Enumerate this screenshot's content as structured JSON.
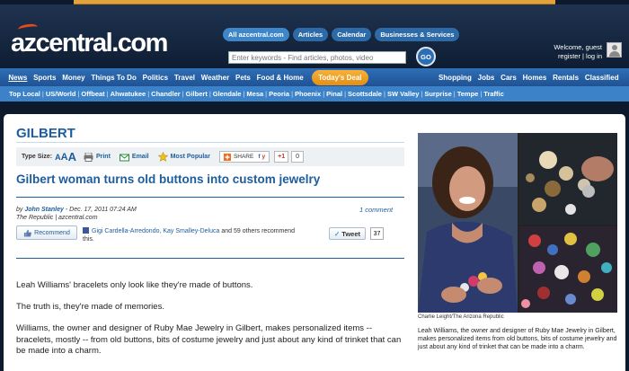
{
  "header": {
    "logo_text": "azcentral.com",
    "pills": [
      "All azcentral.com",
      "Articles",
      "Calendar",
      "Businesses & Services"
    ],
    "search_placeholder": "Enter keywords - Find articles, photos, video",
    "go_label": "GO",
    "welcome": "Welcome, guest",
    "account_links": "register | log in"
  },
  "nav": {
    "left": [
      "News",
      "Sports",
      "Money",
      "Things To Do",
      "Politics",
      "Travel",
      "Weather",
      "Pets",
      "Food & Home"
    ],
    "deal": "Today's Deal",
    "right": [
      "Shopping",
      "Jobs",
      "Cars",
      "Homes",
      "Rentals",
      "Classified"
    ]
  },
  "subnav": [
    "Top Local",
    "US/World",
    "Offbeat",
    "Ahwatukee",
    "Chandler",
    "Gilbert",
    "Glendale",
    "Mesa",
    "Peoria",
    "Phoenix",
    "Pinal",
    "Scottsdale",
    "SW Valley",
    "Surprise",
    "Tempe",
    "Traffic"
  ],
  "article": {
    "section": "GILBERT",
    "tools": {
      "type_size_label": "Type Size:",
      "size_a": "A",
      "print": "Print",
      "email": "Email",
      "most_popular": "Most Popular",
      "share": "SHARE",
      "plus": "+1",
      "plus_count": "0"
    },
    "headline": "Gilbert woman turns old buttons into custom jewelry",
    "byline_prefix": "by ",
    "author": "John Stanley",
    "date": " - Dec. 17, 2011 07:24 AM",
    "source": "The Republic | azcentral.com",
    "comment_link": "1 comment",
    "recommend_label": "Recommend",
    "recommend_names": "Gigi Cardella-Arredondo, Kay Smalley-Deluca",
    "recommend_rest": " and 59 others recommend this.",
    "tweet_label": "Tweet",
    "tweet_count": "37",
    "paragraphs": [
      "Leah Williams' bracelets only look like they're made of buttons.",
      "The truth is, they're made of memories.",
      "Williams, the owner and designer of Ruby Mae Jewelry in Gilbert, makes personalized items -- bracelets, mostly -- from old buttons, bits of costume jewelry and just about any kind of trinket that can be made into a charm."
    ]
  },
  "photo": {
    "credit": "Charlie Leight/The Arizona Republic",
    "caption": "Leah Williams, the owner and designer of Ruby Mae Jewelry in Gilbert, makes personalized items from old buttons, bits of costume jewelry and just about any kind of trinket that can be made into a charm."
  }
}
